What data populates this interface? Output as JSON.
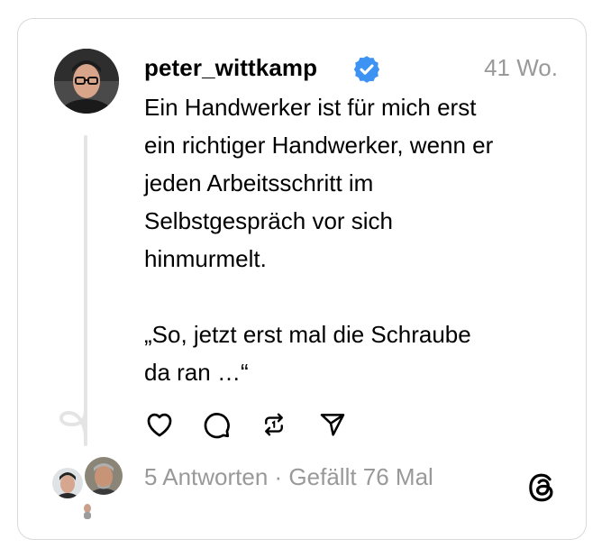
{
  "post": {
    "username": "peter_wittkamp",
    "time": "41 Wo.",
    "text": "Ein Handwerker ist für mich erst\nein richtiger Handwerker, wenn er\njeden Arbeitsschritt im\nSelbstgespräch vor sich\nhinmurmelt.\n\n„So, jetzt erst mal die Schraube\nda ran …“"
  },
  "stats": {
    "replies": "5 Antworten",
    "separator": " · ",
    "likes": "Gefällt 76 Mal"
  },
  "icons": {
    "verified": "verified-badge-icon",
    "like": "heart-icon",
    "reply": "comment-icon",
    "repost": "repost-icon",
    "share": "send-icon",
    "brand": "threads-logo-icon"
  },
  "colors": {
    "verified": "#3d93f4",
    "muted": "#999999",
    "border": "#d9d9d9",
    "thread_line": "#e4e4e4"
  }
}
